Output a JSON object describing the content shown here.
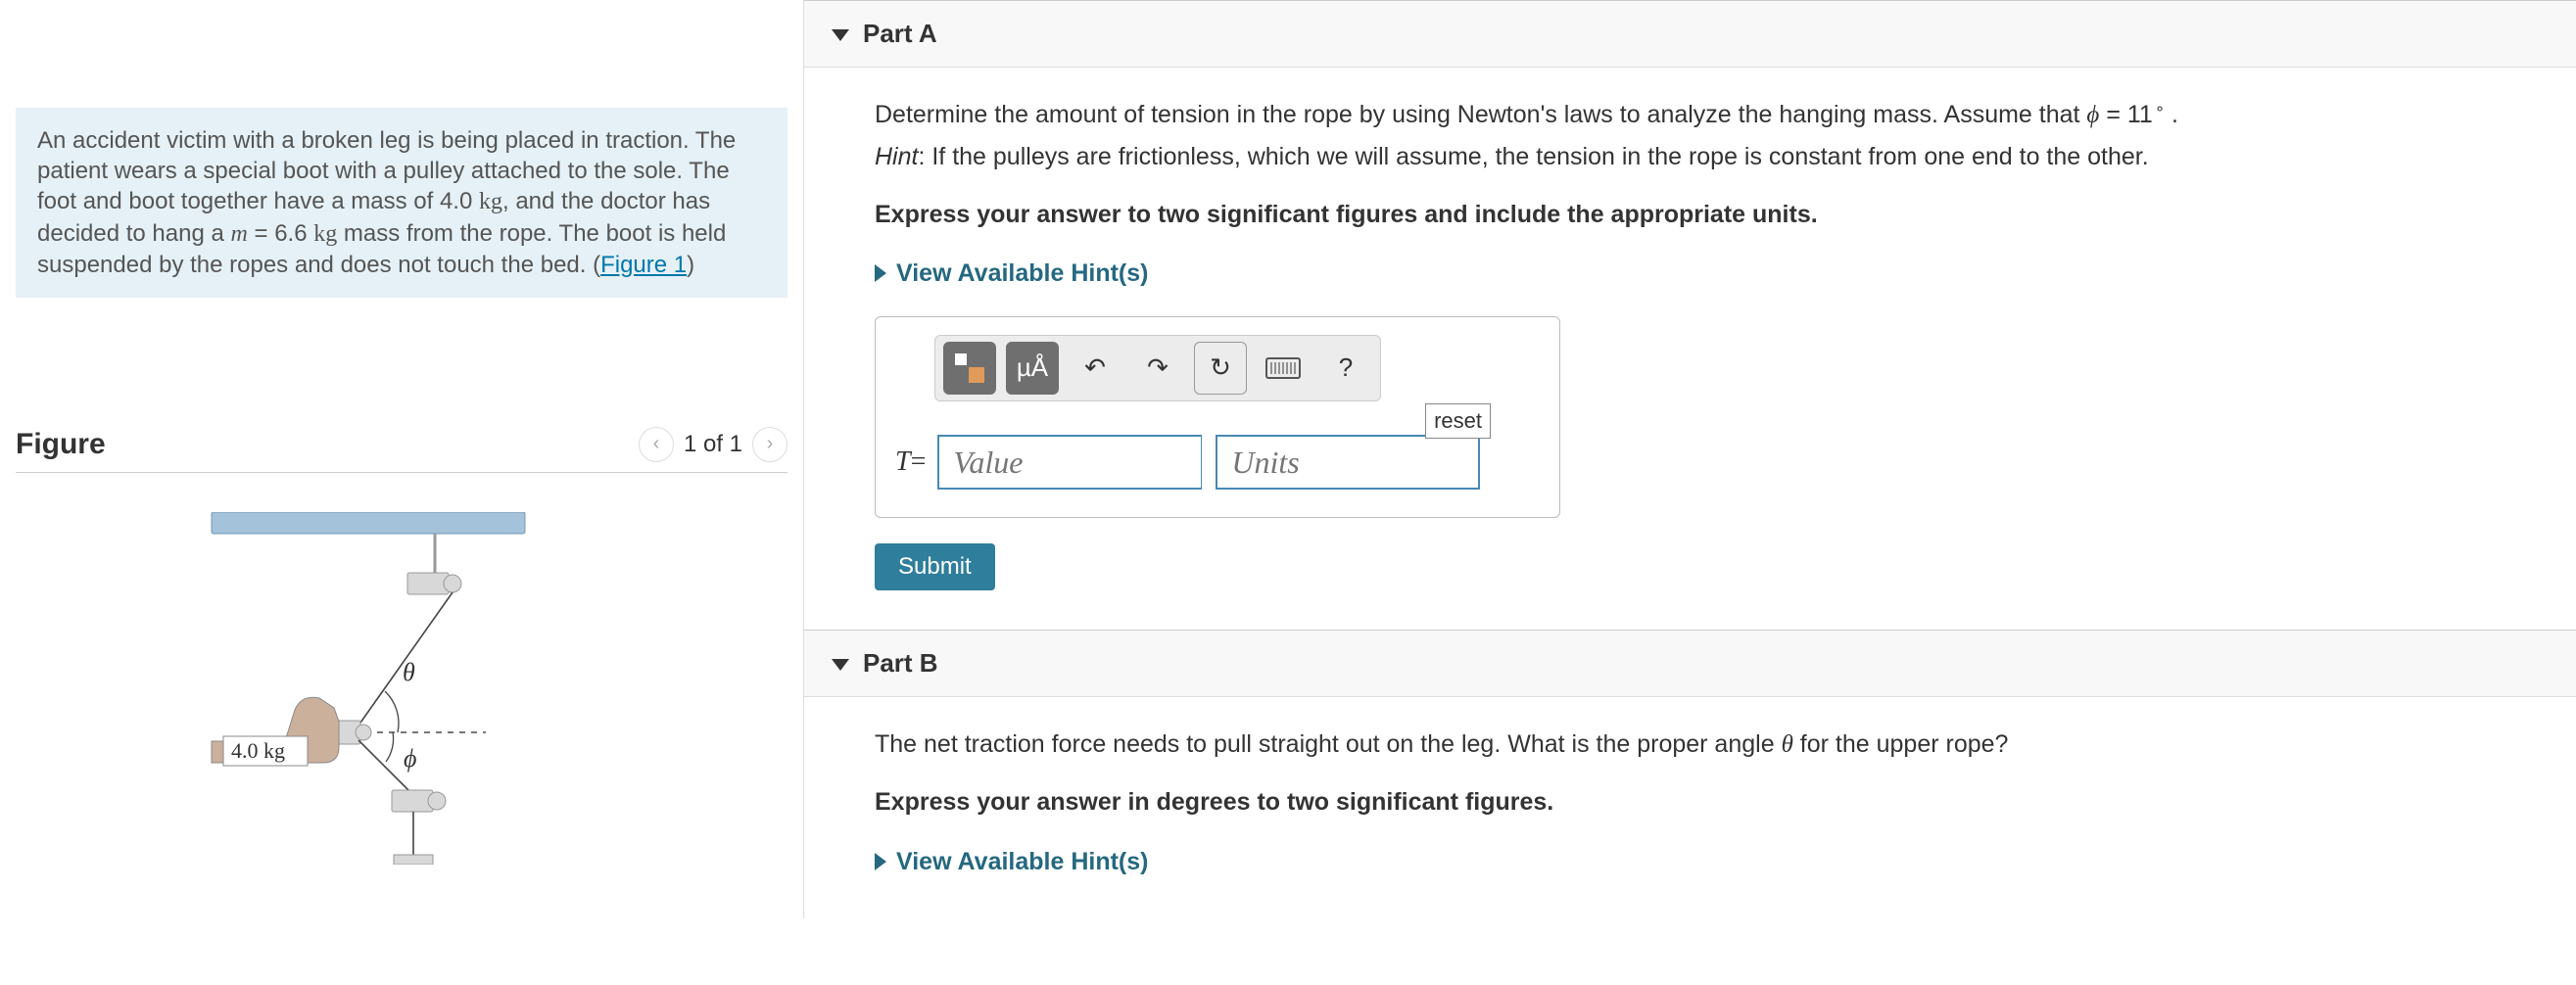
{
  "problem": {
    "text_pre": "An accident victim with a broken leg is being placed in traction. The patient wears a special boot with a pulley attached to the sole. The foot and boot together have a mass of 4.0 ",
    "unit_kg": "kg",
    "text_mid": ", and the doctor has decided to hang a ",
    "var_m": "m",
    "eq": " = 6.6 ",
    "text_end": " mass from the rope. The boot is held suspended by the ropes and does not touch the bed. (",
    "figure_link": "Figure 1",
    "close_paren": ")"
  },
  "figure": {
    "title": "Figure",
    "counter": "1 of 1",
    "boot_label": "4.0 kg",
    "theta": "θ",
    "phi": "ϕ"
  },
  "partA": {
    "title": "Part A",
    "question": "Determine the amount of tension in the rope by using Newton's laws to analyze the hanging mass. Assume that ",
    "phi_sym": "ϕ",
    "phi_val": " = 11",
    "period": " .",
    "hint_label": "Hint",
    "hint_text": ": If the pulleys are frictionless, which we will assume, the tension in the rope is constant from one end to the other.",
    "instruct": "Express your answer to two significant figures and include the appropriate units.",
    "view_hints": "View Available Hint(s)",
    "toolbar": {
      "mu_a": "µÅ",
      "undo": "↶",
      "redo": "↷",
      "reset_sym": "↻",
      "help": "?",
      "reset_label": "reset"
    },
    "var": "T",
    "eqs": " = ",
    "value_ph": "Value",
    "units_ph": "Units",
    "submit": "Submit"
  },
  "partB": {
    "title": "Part B",
    "question_pre": "The net traction force needs to pull straight out on the leg. What is the proper angle ",
    "theta": "θ",
    "question_post": " for the upper rope?",
    "instruct": "Express your answer in degrees to two significant figures.",
    "view_hints": "View Available Hint(s)"
  }
}
